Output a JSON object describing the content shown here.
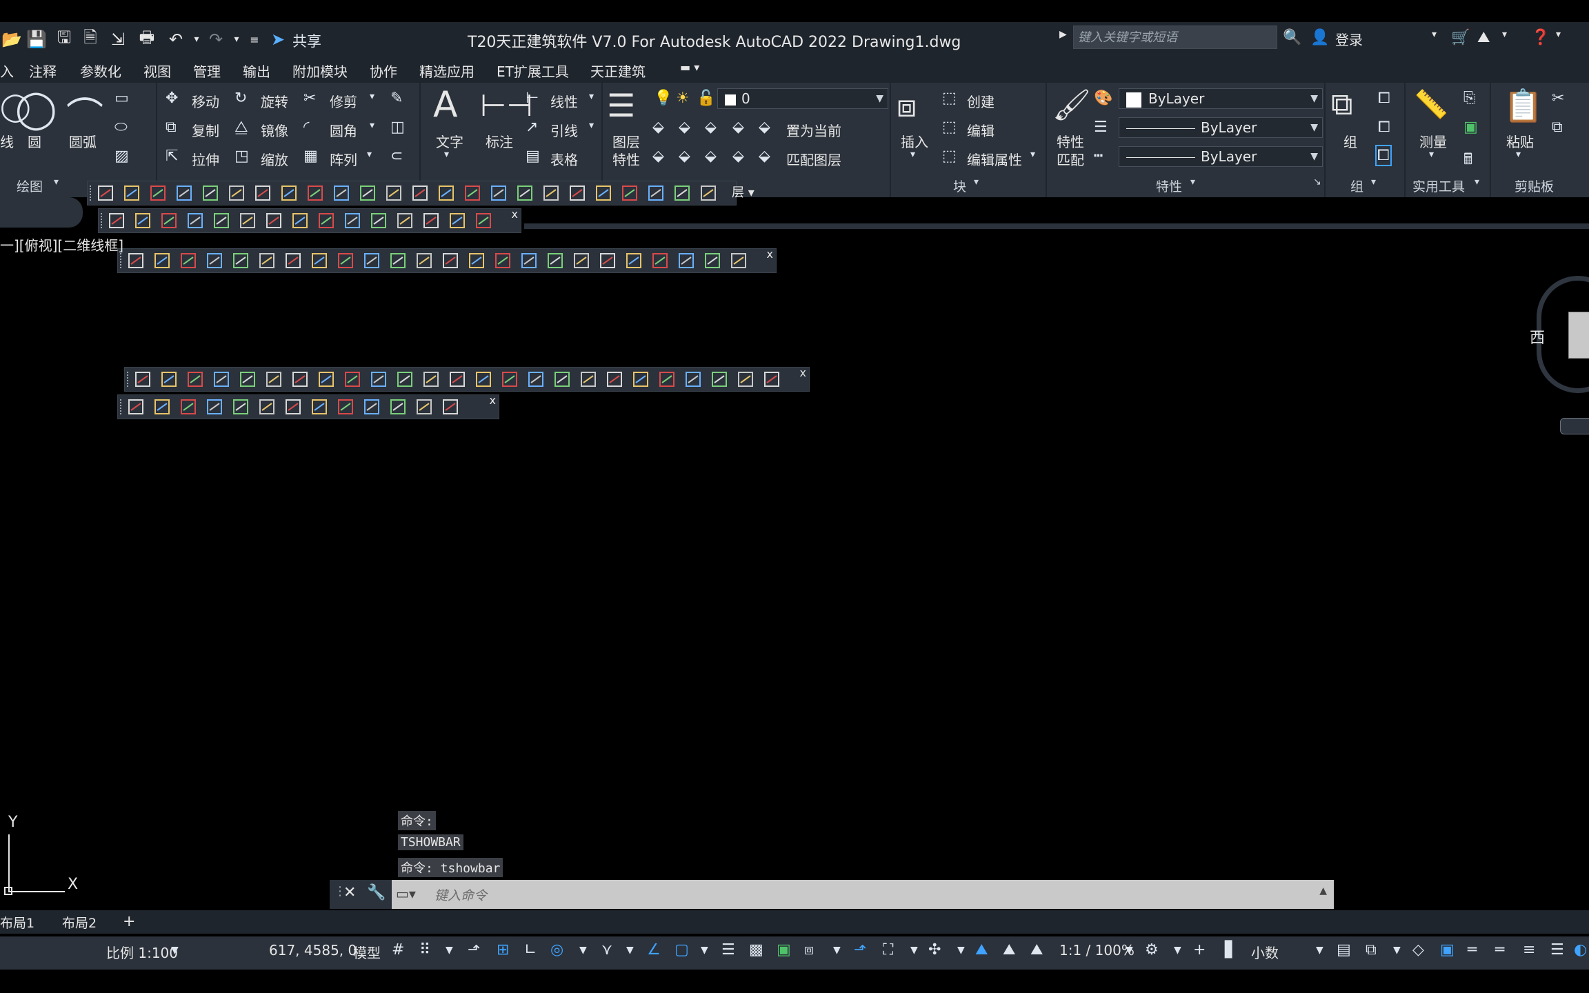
{
  "titlebar": {
    "share_label": "共享",
    "title": "T20天正建筑软件 V7.0 For Autodesk AutoCAD 2022    Drawing1.dwg",
    "search_placeholder": "键入关键字或短语",
    "login_label": "登录"
  },
  "menu": {
    "items": [
      "入",
      "注释",
      "参数化",
      "视图",
      "管理",
      "输出",
      "附加模块",
      "协作",
      "精选应用",
      "ET扩展工具",
      "天正建筑"
    ]
  },
  "ribbon": {
    "draw": {
      "line": "线",
      "circle": "圆",
      "arc": "圆弧",
      "title": "绘图"
    },
    "modify": {
      "move": "移动",
      "rotate": "旋转",
      "trim": "修剪",
      "copy": "复制",
      "mirror": "镜像",
      "fillet": "圆角",
      "stretch": "拉伸",
      "scale": "缩放",
      "array": "阵列"
    },
    "annotation": {
      "text": "文字",
      "dimension": "标注",
      "linear": "线性",
      "leader": "引线",
      "table": "表格"
    },
    "layers": {
      "properties_line1": "图层",
      "properties_line2": "特性",
      "current_layer": "0",
      "set_current": "置为当前",
      "match_layer": "匹配图层",
      "title_fragment": "层"
    },
    "block": {
      "insert": "插入",
      "create": "创建",
      "edit": "编辑",
      "edit_attr": "编辑属性",
      "title": "块"
    },
    "properties": {
      "match_line1": "特性",
      "match_line2": "匹配",
      "color": "ByLayer",
      "linetype": "ByLayer",
      "lineweight": "ByLayer",
      "title": "特性"
    },
    "groups": {
      "group": "组",
      "title": "组"
    },
    "utilities": {
      "measure": "测量",
      "title": "实用工具"
    },
    "clipboard": {
      "paste": "粘贴",
      "title": "剪贴板"
    }
  },
  "canvas": {
    "viewport_label": "一][俯视][二维线框]",
    "compass_west": "西",
    "ucs_x": "X",
    "ucs_y": "Y"
  },
  "command": {
    "history": [
      "命令:",
      "TSHOWBAR",
      "命令: tshowbar"
    ],
    "placeholder": "键入命令"
  },
  "layout_tabs": [
    "布局1",
    "布局2"
  ],
  "status": {
    "scale": "比例 1:100",
    "coords": "617, 4585, 0",
    "model": "模型",
    "annotation_scale": "1:1 / 100%",
    "units": "小数"
  },
  "colors": {
    "accent": "#3fa3ff",
    "panel": "#2b323b",
    "titlebar": "#1f252d"
  }
}
